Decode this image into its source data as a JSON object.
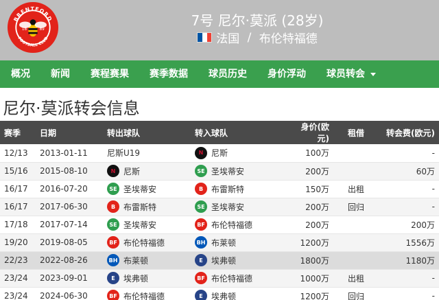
{
  "header": {
    "title": "7号 尼尔·莫派 (28岁)",
    "country": "法国",
    "separator": " / ",
    "club": "布伦特福德",
    "logo_text": "BRENTFORD",
    "logo_bottom": "FOOTBALL CLUB",
    "logo_year_left": "18",
    "logo_year_right": "89"
  },
  "nav": [
    {
      "label": "概况"
    },
    {
      "label": "新闻"
    },
    {
      "label": "赛程赛果"
    },
    {
      "label": "赛季数据"
    },
    {
      "label": "球员历史"
    },
    {
      "label": "身价浮动"
    },
    {
      "label": "球员转会"
    }
  ],
  "page_title": "尼尔·莫派转会信息",
  "table": {
    "headers": [
      "赛季",
      "日期",
      "转出球队",
      "转入球队",
      "身价(欧元)",
      "租借",
      "转会费(欧元)"
    ],
    "rows": [
      {
        "season": "12/13",
        "date": "2013-01-11",
        "from": "尼斯U19",
        "from_icon": "",
        "to": "尼斯",
        "to_icon": "nice",
        "value": "100万",
        "loan": "",
        "fee": "-"
      },
      {
        "season": "15/16",
        "date": "2015-08-10",
        "from": "尼斯",
        "from_icon": "nice",
        "to": "圣埃蒂安",
        "to_icon": "stetienne",
        "value": "200万",
        "loan": "",
        "fee": "60万"
      },
      {
        "season": "16/17",
        "date": "2016-07-20",
        "from": "圣埃蒂安",
        "from_icon": "stetienne",
        "to": "布雷斯特",
        "to_icon": "brest",
        "value": "150万",
        "loan": "出租",
        "fee": "-"
      },
      {
        "season": "16/17",
        "date": "2017-06-30",
        "from": "布雷斯特",
        "from_icon": "brest",
        "to": "圣埃蒂安",
        "to_icon": "stetienne",
        "value": "200万",
        "loan": "回归",
        "fee": "-"
      },
      {
        "season": "17/18",
        "date": "2017-07-14",
        "from": "圣埃蒂安",
        "from_icon": "stetienne",
        "to": "布伦特福德",
        "to_icon": "brentford",
        "value": "200万",
        "loan": "",
        "fee": "200万"
      },
      {
        "season": "19/20",
        "date": "2019-08-05",
        "from": "布伦特福德",
        "from_icon": "brentford",
        "to": "布莱顿",
        "to_icon": "brighton",
        "value": "1200万",
        "loan": "",
        "fee": "1556万"
      },
      {
        "season": "22/23",
        "date": "2022-08-26",
        "from": "布莱顿",
        "from_icon": "brighton",
        "to": "埃弗顿",
        "to_icon": "everton",
        "value": "1800万",
        "loan": "",
        "fee": "1180万"
      },
      {
        "season": "23/24",
        "date": "2023-09-01",
        "from": "埃弗顿",
        "from_icon": "everton",
        "to": "布伦特福德",
        "to_icon": "brentford",
        "value": "1000万",
        "loan": "出租",
        "fee": "-"
      },
      {
        "season": "23/24",
        "date": "2024-06-30",
        "from": "布伦特福德",
        "from_icon": "brentford",
        "to": "埃弗顿",
        "to_icon": "everton",
        "value": "1200万",
        "loan": "回归",
        "fee": "-"
      }
    ]
  },
  "colors": {
    "header_bg": "#bdbdbd",
    "nav_bg": "#3aa04e",
    "table_header_bg": "#4a4a4a"
  }
}
